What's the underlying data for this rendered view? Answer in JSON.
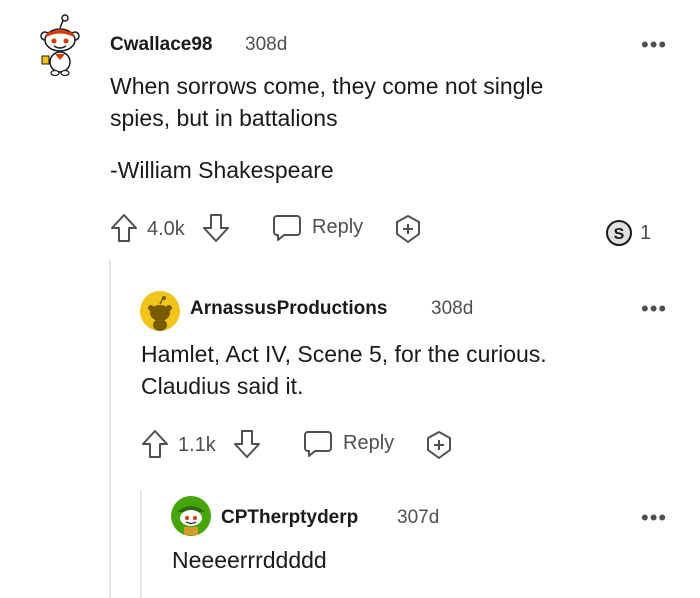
{
  "comments": [
    {
      "username": "Cwallace98",
      "time": "308d",
      "body_lines": [
        "When sorrows come, they come not single",
        "spies, but in battalions"
      ],
      "signature": "-William Shakespeare",
      "score": "4.0k",
      "reply_label": "Reply",
      "award_count": "1",
      "avatar_icon": "snoo-avatar-icon"
    },
    {
      "username": "ArnassusProductions",
      "time": "308d",
      "body_lines": [
        "Hamlet, Act IV, Scene 5, for the curious.",
        "Claudius said it."
      ],
      "score": "1.1k",
      "reply_label": "Reply",
      "avatar_icon": "snoo-avatar-icon"
    },
    {
      "username": "CPTherptyderp",
      "time": "307d",
      "body_lines": [
        "Neeeerrrddddd"
      ],
      "avatar_icon": "snoo-avatar-icon"
    }
  ],
  "colors": {
    "accent_red": "#d93a00",
    "text": "#1a1a1b",
    "meta": "#4f4f4f",
    "thread_line": "#e5e5e5",
    "avatar_yellow": "#f0c419",
    "avatar_green": "#46a508"
  }
}
